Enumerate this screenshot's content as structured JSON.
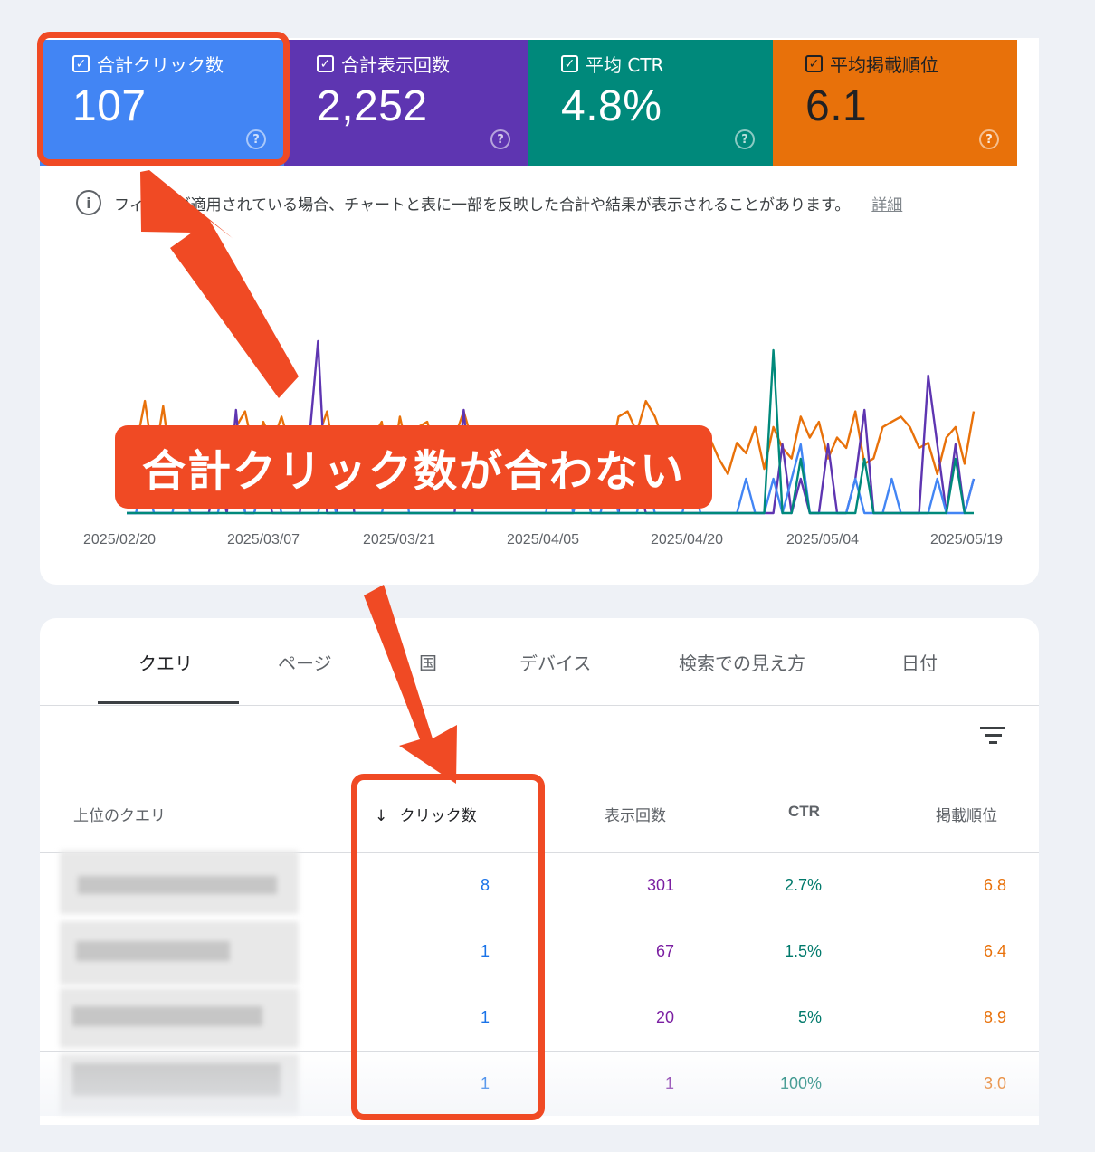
{
  "metrics": [
    {
      "label": "合計クリック数",
      "value": "107",
      "color": "#4285f4"
    },
    {
      "label": "合計表示回数",
      "value": "2,252",
      "color": "#5e35b1"
    },
    {
      "label": "平均 CTR",
      "value": "4.8%",
      "color": "#00897b"
    },
    {
      "label": "平均掲載順位",
      "value": "6.1",
      "color": "#e8710a"
    }
  ],
  "help_glyph": "?",
  "notice": {
    "text": "フィルタが適用されている場合、チャートと表に一部を反映した合計や結果が表示されることがあります。",
    "link": "詳細"
  },
  "chart_data": {
    "type": "line",
    "x_ticks": [
      "2025/02/20",
      "2025/03/07",
      "2025/03/21",
      "2025/04/05",
      "2025/04/20",
      "2025/05/04",
      "2025/05/19"
    ],
    "series": [
      {
        "name": "合計表示回数",
        "color": "#e8710a",
        "values": [
          22,
          29,
          38,
          26,
          37,
          24,
          28,
          31,
          26,
          25,
          30,
          27,
          33,
          36,
          28,
          34,
          30,
          35,
          29,
          27,
          33,
          31,
          36,
          25,
          30,
          31,
          28,
          31,
          34,
          24,
          35,
          27,
          33,
          34,
          28,
          33,
          31,
          36,
          30,
          29,
          25,
          29,
          33,
          26,
          31,
          27,
          30,
          28,
          32,
          25,
          30,
          29,
          24,
          26,
          35,
          36,
          32,
          38,
          35,
          30,
          33,
          30,
          26,
          33,
          31,
          27,
          24,
          30,
          28,
          33,
          25,
          33,
          29,
          27,
          35,
          31,
          34,
          27,
          31,
          29,
          36,
          26,
          27,
          33,
          34,
          35,
          33,
          29,
          30,
          24,
          31,
          33,
          26,
          36
        ]
      },
      {
        "name": "合計クリック数",
        "color": "#4285f4",
        "values": [
          0,
          0,
          1,
          0,
          0,
          0,
          1,
          0,
          0,
          0,
          0,
          1,
          2,
          0,
          0,
          1,
          1,
          0,
          0,
          0,
          0,
          0,
          1,
          0,
          0,
          0,
          0,
          0,
          0,
          1,
          2,
          0,
          0,
          0,
          0,
          0,
          0,
          0,
          0,
          0,
          0,
          0,
          0,
          0,
          0,
          0,
          0,
          1,
          2,
          0,
          1,
          0,
          0,
          1,
          0,
          0,
          0,
          1,
          0,
          0,
          0,
          0,
          1,
          0,
          0,
          0,
          0,
          0,
          1,
          0,
          0,
          1,
          0,
          1,
          2,
          0,
          0,
          0,
          0,
          0,
          1,
          0,
          0,
          0,
          1,
          0,
          0,
          0,
          0,
          1,
          0,
          0,
          0,
          1
        ]
      },
      {
        "name": "合計表示回数 (scaled)",
        "color": "#5e35b1",
        "values": [
          0,
          0,
          0,
          0,
          0,
          0,
          0,
          0,
          0,
          0,
          1,
          0,
          3,
          0,
          0,
          1,
          0,
          0,
          0,
          0,
          2,
          5,
          0,
          0,
          2,
          0,
          0,
          0,
          0,
          0,
          0,
          0,
          0,
          0,
          0,
          0,
          0,
          3,
          0,
          0,
          0,
          0,
          0,
          0,
          0,
          0,
          0,
          0,
          0,
          0,
          1,
          0,
          0,
          0,
          0,
          2,
          1,
          0,
          0,
          0,
          0,
          0,
          0,
          0,
          0,
          0,
          0,
          0,
          0,
          0,
          0,
          0,
          2,
          0,
          1,
          0,
          0,
          2,
          0,
          0,
          1,
          3,
          0,
          0,
          0,
          0,
          0,
          0,
          4,
          2,
          0,
          2,
          0,
          1
        ]
      },
      {
        "name": "平均 CTR",
        "color": "#00897b",
        "values": [
          0,
          0,
          0,
          0,
          0,
          0,
          0,
          0,
          0,
          0,
          0,
          0,
          0,
          0,
          0,
          0,
          0,
          0,
          0,
          0,
          0,
          0,
          0,
          0,
          0,
          0,
          0,
          0,
          0,
          0,
          0,
          0,
          0,
          0,
          0,
          0,
          0,
          0,
          0,
          0,
          0,
          0,
          0,
          0,
          0,
          0,
          0,
          0,
          0,
          0,
          0,
          0,
          0,
          0,
          0,
          0,
          0,
          0,
          0,
          0,
          0,
          0,
          0,
          0,
          0,
          0,
          0,
          0,
          0,
          0,
          0,
          3,
          0,
          0,
          1,
          0,
          0,
          0,
          0,
          0,
          0,
          1,
          0,
          0,
          0,
          0,
          0,
          0,
          0,
          0,
          0,
          1,
          0,
          0
        ]
      }
    ]
  },
  "tabs": [
    "クエリ",
    "ページ",
    "国",
    "デバイス",
    "検索での見え方",
    "日付"
  ],
  "table": {
    "headers": {
      "query": "上位のクエリ",
      "sort_arrow": "↓",
      "clicks": "クリック数",
      "impressions": "表示回数",
      "ctr": "CTR",
      "position": "掲載順位"
    },
    "rows": [
      {
        "clicks": "8",
        "impressions": "301",
        "ctr": "2.7%",
        "position": "6.8"
      },
      {
        "clicks": "1",
        "impressions": "67",
        "ctr": "1.5%",
        "position": "6.4"
      },
      {
        "clicks": "1",
        "impressions": "20",
        "ctr": "5%",
        "position": "8.9"
      },
      {
        "clicks": "1",
        "impressions": "1",
        "ctr": "100%",
        "position": "3.0"
      }
    ]
  },
  "annotation": {
    "callout": "合計クリック数が合わない",
    "color": "#f04a24"
  }
}
